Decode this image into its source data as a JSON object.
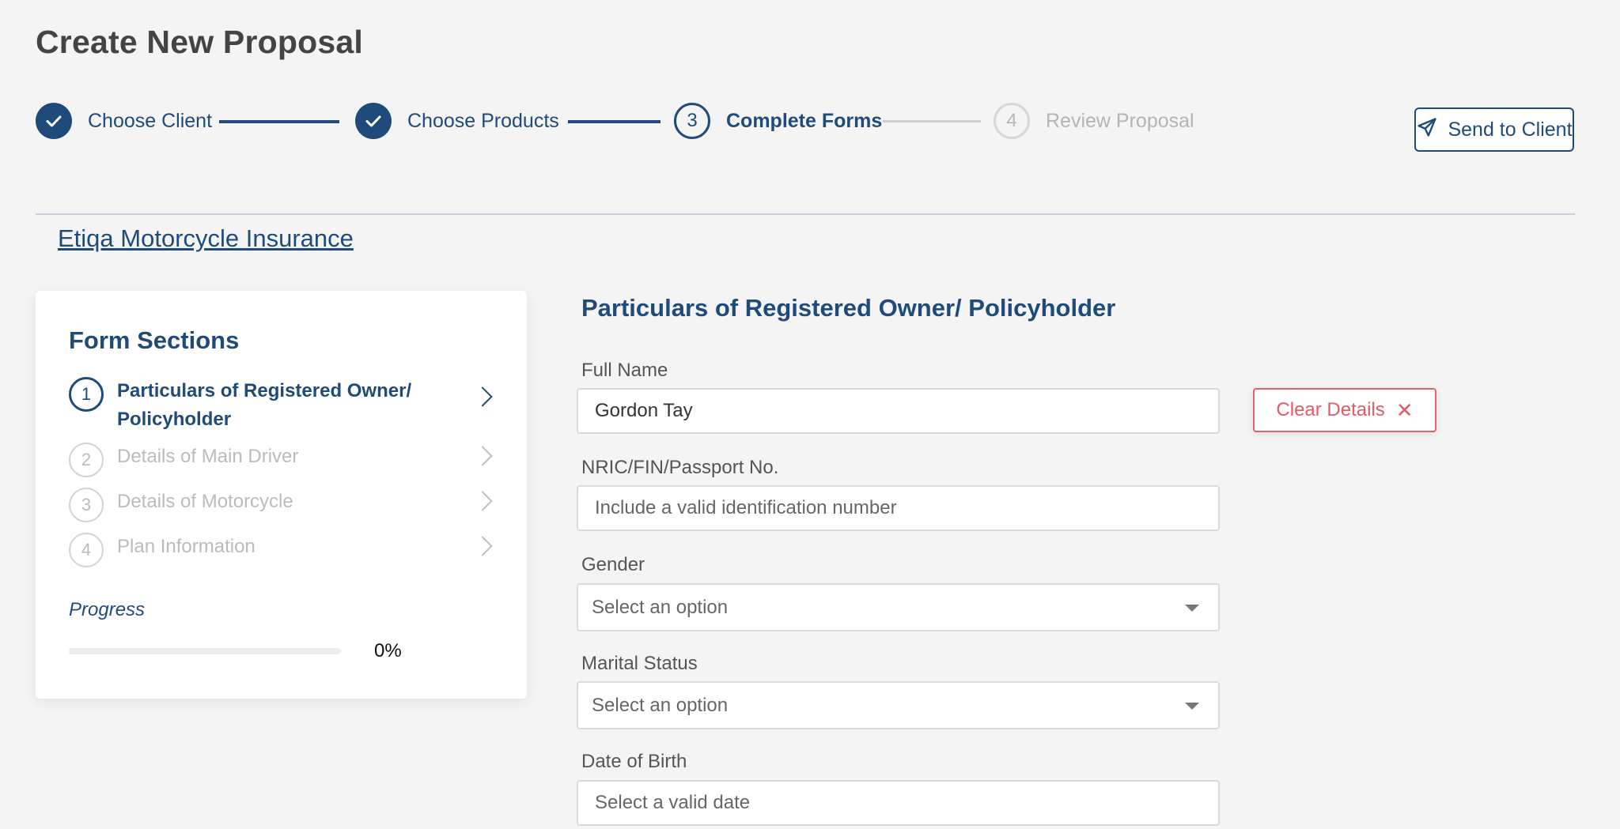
{
  "page": {
    "title": "Create New Proposal"
  },
  "stepper": {
    "steps": [
      {
        "number": "1",
        "label": "Choose Client",
        "state": "done"
      },
      {
        "number": "2",
        "label": "Choose Products",
        "state": "done"
      },
      {
        "number": "3",
        "label": "Complete Forms",
        "state": "active"
      },
      {
        "number": "4",
        "label": "Review Proposal",
        "state": "pending"
      }
    ]
  },
  "header": {
    "send_label": "Send to Client",
    "send_icon": "paper-plane-icon"
  },
  "product": {
    "name": "Etiqa Motorcycle Insurance"
  },
  "sidebar": {
    "title": "Form Sections",
    "items": [
      {
        "number": "1",
        "label": "Particulars of Registered Owner/ Policyholder",
        "active": true
      },
      {
        "number": "2",
        "label": "Details of Main Driver",
        "active": false
      },
      {
        "number": "3",
        "label": "Details of Motorcycle",
        "active": false
      },
      {
        "number": "4",
        "label": "Plan Information",
        "active": false
      }
    ],
    "progress_label": "Progress",
    "progress_value": "0%",
    "progress_fraction": 0
  },
  "form": {
    "title": "Particulars of Registered Owner/ Policyholder",
    "full_name": {
      "label": "Full Name",
      "value": "Gordon Tay"
    },
    "nric": {
      "label": "NRIC/FIN/Passport No.",
      "placeholder": "Include a valid identification number"
    },
    "gender": {
      "label": "Gender",
      "placeholder": "Select an option"
    },
    "marital_status": {
      "label": "Marital Status",
      "placeholder": "Select an option"
    },
    "dob": {
      "label": "Date of Birth",
      "placeholder": "Select a valid date"
    },
    "clear_label": "Clear Details",
    "clear_icon": "close-icon"
  },
  "colors": {
    "primary": "#1f4b7a",
    "danger": "#e05b66",
    "background": "#f4f4f4",
    "pending": "#b4b4b4"
  }
}
